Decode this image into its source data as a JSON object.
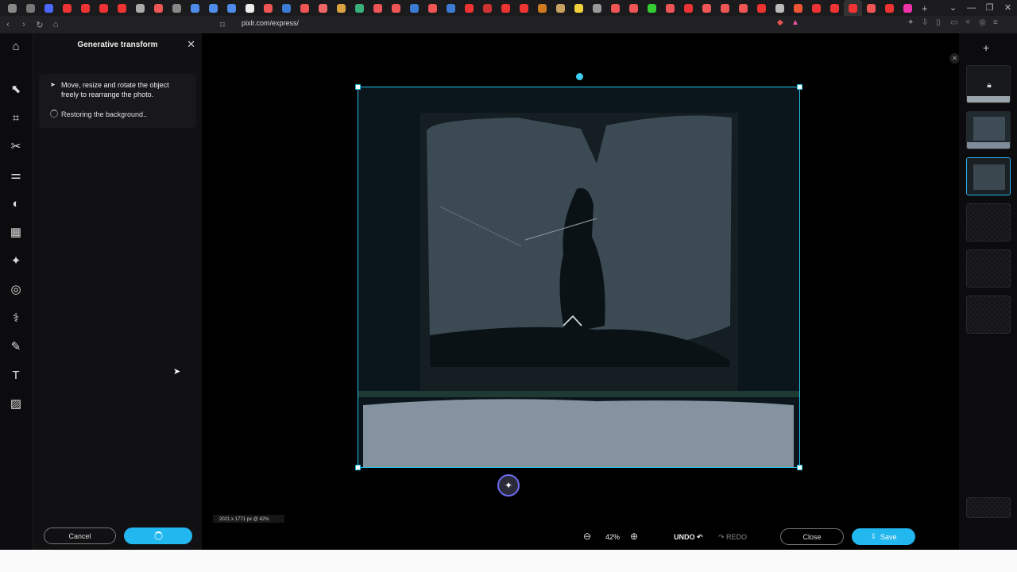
{
  "browser": {
    "url": "pixlr.com/express/",
    "tab_colors": [
      "#888",
      "#777",
      "#4a67ff",
      "#e33",
      "#e33",
      "#e33",
      "#e33",
      "#aaa",
      "#e55",
      "#888",
      "#4f8be8",
      "#4f8be8",
      "#4f8be8",
      "#eee",
      "#e55",
      "#3b7bd4",
      "#e55",
      "#e66",
      "#d9a23e",
      "#3ab07a",
      "#e55",
      "#e55",
      "#3b7bd4",
      "#e55",
      "#3b7bd4",
      "#e33",
      "#c33",
      "#e33",
      "#e33",
      "#d07a20",
      "#c8a060",
      "#f2d23c",
      "#999",
      "#e55",
      "#e55",
      "#3c3",
      "#e55",
      "#e33",
      "#e55",
      "#e55",
      "#e55",
      "#e33",
      "#bbb",
      "#e53",
      "#e33",
      "#e33",
      "#e33",
      "#e55",
      "#e33",
      "#e3a"
    ]
  },
  "toolbar": {
    "tools": [
      "arrange-icon",
      "crop-icon",
      "cutout-icon",
      "adjust-icon",
      "filter-icon",
      "effect-icon",
      "magic-icon",
      "liquify-icon",
      "heal-icon",
      "draw-icon",
      "text-icon",
      "pattern-icon"
    ]
  },
  "panel": {
    "title": "Generative transform",
    "step1": "Move, resize and rotate the object freely to rearrange the photo.",
    "step2": "Restoring the background..",
    "cancel_label": "Cancel"
  },
  "canvas": {
    "dims": "2021 x 1771 px @ 42%"
  },
  "bottom": {
    "zoom": "42%",
    "undo": "UNDO",
    "redo": "REDO",
    "close": "Close",
    "save": "Save"
  },
  "colors": {
    "accent": "#22b7ef",
    "selection": "#1fc1ea"
  }
}
